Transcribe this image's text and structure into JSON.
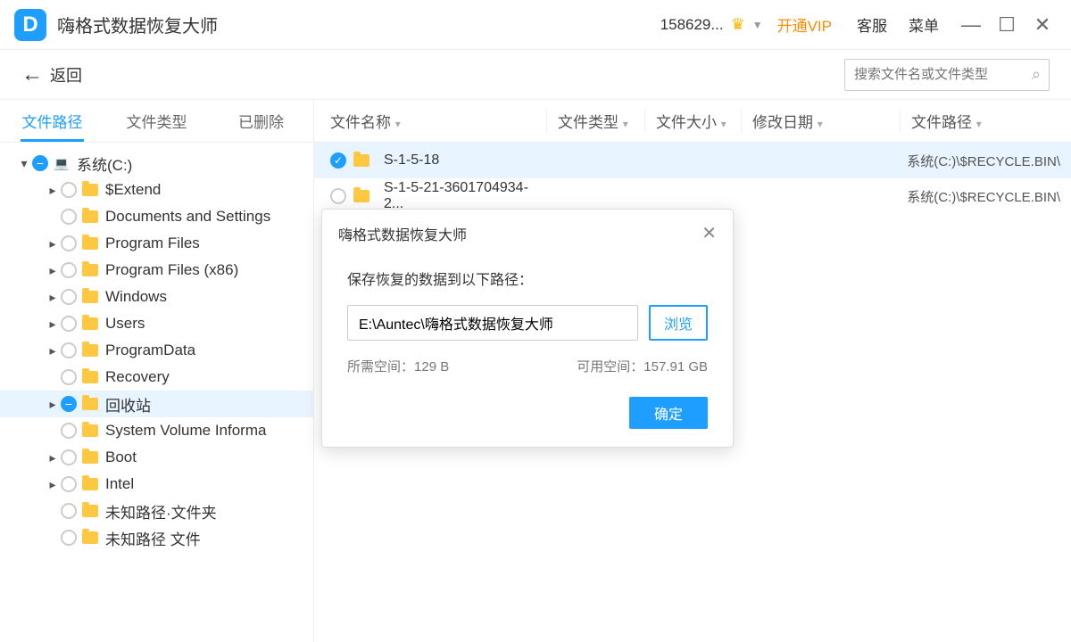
{
  "app": {
    "title": "嗨格式数据恢复大师",
    "logo_letter": "D"
  },
  "header": {
    "user": "158629...",
    "vip": "开通VIP",
    "support": "客服",
    "menu": "菜单"
  },
  "toolbar": {
    "back": "返回",
    "search_placeholder": "搜索文件名或文件类型"
  },
  "sidebar": {
    "tabs": [
      "文件路径",
      "文件类型",
      "已删除"
    ],
    "tree": [
      {
        "indent": 0,
        "chev": "▾",
        "check": "minus",
        "icon": "drive",
        "label": "系统(C:)"
      },
      {
        "indent": 1,
        "chev": "▸",
        "check": "none",
        "icon": "folder",
        "label": "$Extend"
      },
      {
        "indent": 1,
        "chev": "",
        "check": "none",
        "icon": "folder",
        "label": "Documents and Settings"
      },
      {
        "indent": 1,
        "chev": "▸",
        "check": "none",
        "icon": "folder",
        "label": "Program Files"
      },
      {
        "indent": 1,
        "chev": "▸",
        "check": "none",
        "icon": "folder",
        "label": "Program Files (x86)"
      },
      {
        "indent": 1,
        "chev": "▸",
        "check": "none",
        "icon": "folder",
        "label": "Windows"
      },
      {
        "indent": 1,
        "chev": "▸",
        "check": "none",
        "icon": "folder",
        "label": "Users"
      },
      {
        "indent": 1,
        "chev": "▸",
        "check": "none",
        "icon": "folder",
        "label": "ProgramData"
      },
      {
        "indent": 1,
        "chev": "",
        "check": "none",
        "icon": "folder",
        "label": "Recovery"
      },
      {
        "indent": 1,
        "chev": "▸",
        "check": "minus",
        "icon": "folder",
        "label": "回收站",
        "selected": true
      },
      {
        "indent": 1,
        "chev": "",
        "check": "none",
        "icon": "folder",
        "label": "System Volume Informa"
      },
      {
        "indent": 1,
        "chev": "▸",
        "check": "none",
        "icon": "folder",
        "label": "Boot"
      },
      {
        "indent": 1,
        "chev": "▸",
        "check": "none",
        "icon": "folder",
        "label": "Intel"
      },
      {
        "indent": 1,
        "chev": "",
        "check": "none",
        "icon": "folder",
        "label": "未知路径·文件夹"
      },
      {
        "indent": 1,
        "chev": "",
        "check": "none",
        "icon": "folder",
        "label": "未知路径 文件"
      }
    ]
  },
  "columns": {
    "name": "文件名称",
    "type": "文件类型",
    "size": "文件大小",
    "date": "修改日期",
    "path": "文件路径"
  },
  "files": [
    {
      "name": "S-1-5-18",
      "path": "系统(C:)\\$RECYCLE.BIN\\",
      "selected": true,
      "checked": true
    },
    {
      "name": "S-1-5-21-3601704934-2...",
      "path": "系统(C:)\\$RECYCLE.BIN\\",
      "selected": false,
      "checked": false
    }
  ],
  "dialog": {
    "title": "嗨格式数据恢复大师",
    "label": "保存恢复的数据到以下路径：",
    "path": "E:\\Auntec\\嗨格式数据恢复大师",
    "browse": "浏览",
    "needed_label": "所需空间：",
    "needed_value": "129 B",
    "avail_label": "可用空间：",
    "avail_value": "157.91 GB",
    "confirm": "确定"
  }
}
